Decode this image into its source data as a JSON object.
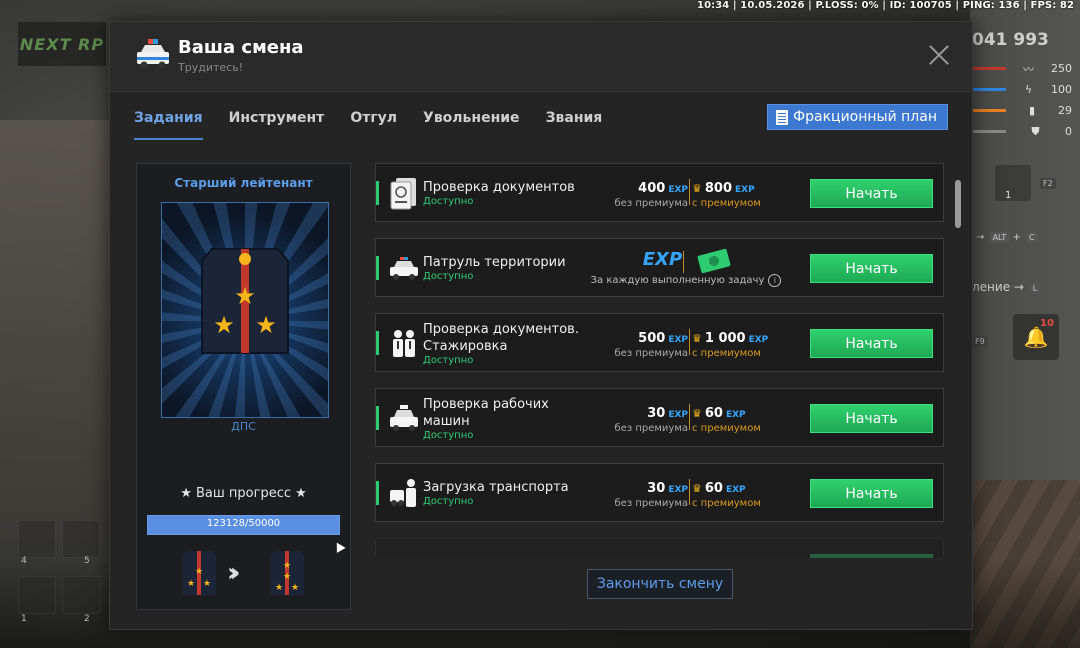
{
  "hud": {
    "status_line": "10:34 | 10.05.2026 | P.LOSS: 0% | ID: 100705 | PING: 136 | FPS: 82",
    "logo": "NEXT RP",
    "money": "041 993",
    "stats": [
      {
        "value": "250",
        "icon": "heartbeat-icon"
      },
      {
        "value": "100",
        "icon": "food-icon"
      },
      {
        "value": "29",
        "icon": "ammo-icon"
      },
      {
        "value": "0",
        "icon": "shield-icon"
      }
    ],
    "slot_count": "1",
    "hint_alt": "ALT",
    "hint_c": "C",
    "hint_l_text": "ление",
    "hint_l": "L",
    "bell_count": "10",
    "f9": "F9",
    "f2": "F2",
    "inv_numbers": [
      "4",
      "5",
      "1",
      "2"
    ]
  },
  "window": {
    "title": "Ваша смена",
    "subtitle": "Трудитесь!",
    "tabs": [
      "Задания",
      "Инструмент",
      "Отгул",
      "Увольнение",
      "Звания"
    ],
    "active_tab": 0,
    "plan_button": "Фракционный план",
    "end_button": "Закончить смену"
  },
  "rank": {
    "name": "Старший лейтенант",
    "branch": "ДПС",
    "progress_label": "★ Ваш прогресс ★",
    "progress_text": "123128/50000",
    "progress_fraction": 1.0
  },
  "tasks": [
    {
      "name": "Проверка документов",
      "status": "Доступно",
      "icon": "passport-icon",
      "base": "400",
      "premium": "800",
      "base_cap": "без премиума",
      "prem_cap": "с премиумом",
      "button": "Начать"
    },
    {
      "name": "Патруль территории",
      "status": "Доступно",
      "icon": "police-car-icon",
      "patrol": true,
      "exp_label": "EXP",
      "patrol_cap": "За каждую выполненную задачу",
      "button": "Начать"
    },
    {
      "name": "Проверка документов. Стажировка",
      "status": "Доступно",
      "icon": "officers-icon",
      "base": "500",
      "premium": "1 000",
      "base_cap": "без премиума",
      "prem_cap": "с премиумом",
      "button": "Начать"
    },
    {
      "name": "Проверка рабочих машин",
      "status": "Доступно",
      "icon": "taxi-icon",
      "base": "30",
      "premium": "60",
      "base_cap": "без премиума",
      "prem_cap": "с премиумом",
      "button": "Начать"
    },
    {
      "name": "Загрузка транспорта",
      "status": "Доступно",
      "icon": "loader-icon",
      "base": "30",
      "premium": "60",
      "base_cap": "без премиума",
      "prem_cap": "с премиумом",
      "button": "Начать"
    }
  ],
  "exp_tag": "EXP",
  "colors": {
    "accent_blue": "#3d78d0",
    "start_green": "#2ecc71",
    "premium_gold": "#f0b21a",
    "exp_blue": "#35a7ff"
  }
}
